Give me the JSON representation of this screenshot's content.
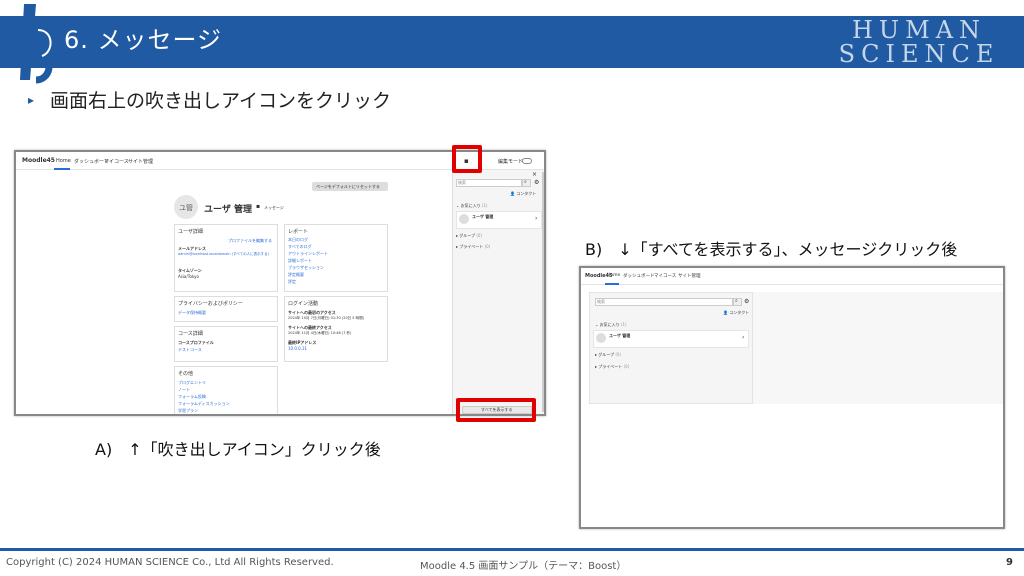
{
  "slide": {
    "title": "6. メッセージ",
    "brand_line1": "HUMAN",
    "brand_line2": "SCIENCE",
    "bullet": "画面右上の吹き出しアイコンをクリック",
    "caption_a": "A)　↑「吹き出しアイコン」クリック後",
    "caption_b": "B)　↓「すべてを表示する」、メッセージクリック後",
    "copyright": "Copyright (C) 2024 HUMAN SCIENCE Co., Ltd All Rights Reserved.",
    "footer_center": "Moodle 4.5 画面サンプル（テーマ：Boost）",
    "page_number": "9"
  },
  "shot_a": {
    "site": "Moodle45",
    "nav": [
      "Home",
      "ダッシュボード",
      "マイコース",
      "サイト管理"
    ],
    "edit_mode": "編集モード",
    "reset_button": "ページをデフォルトにリセットする",
    "avatar_initials": "ユ管",
    "user_name": "ユーザ 管理",
    "message_label": "メッセージ",
    "user_details": {
      "heading": "ユーザ詳細",
      "edit_profile": "プロファイルを編集する",
      "email_label": "メールアドレス",
      "email_value": "admin@localhost.localdomain (すべての人に表示する)",
      "timezone_label": "タイムゾーン",
      "timezone_value": "Asia/Tokyo"
    },
    "privacy": {
      "heading": "プライバシーおよびポリシー",
      "link": "データ保持概要"
    },
    "course": {
      "heading": "コース詳細",
      "label": "コースプロファイル",
      "link": "テストコース"
    },
    "misc": {
      "heading": "その他",
      "links": [
        "ブログエントリ",
        "ノート",
        "フォーラム投稿",
        "フォーラムディスカッション",
        "学習プラン"
      ]
    },
    "reports": {
      "heading": "レポート",
      "links": [
        "本日のログ",
        "すべてのログ",
        "アウトラインレポート",
        "詳細レポート",
        "ブラウザセッション",
        "評定概要",
        "評定"
      ]
    },
    "login": {
      "heading": "ログイン活動",
      "first_label": "サイトへの最初のアクセス",
      "first_value": "2024年 10月 7日(月曜日) 01:30 (20日 5 時間)",
      "last_label": "サイトへの最終アクセス",
      "last_value": "2024年 11月 4日(木曜日) 10:46 (7 秒)",
      "ip_label": "最終IPアドレス",
      "ip_value": "10.0.0.31"
    },
    "drawer": {
      "search_placeholder": "検索",
      "contacts": "コンタクト",
      "starred": "お気に入り",
      "starred_count": "(1)",
      "contact_name": "ユーザ 管理",
      "group": "グループ",
      "group_count": "(0)",
      "private": "プライベート",
      "private_count": "(0)",
      "show_all": "すべてを表示する"
    }
  },
  "shot_b": {
    "site": "Moodle45",
    "nav": [
      "Home",
      "ダッシュボード",
      "マイコース",
      "サイト管理"
    ],
    "search_placeholder": "検索",
    "contacts": "コンタクト",
    "starred": "お気に入り",
    "starred_count": "(1)",
    "contact_name": "ユーザ 管理",
    "group": "グループ",
    "group_count": "(0)",
    "private": "プライベート",
    "private_count": "(0)"
  },
  "colors": {
    "header_blue": "#1f5aa3",
    "highlight_red": "#e00000",
    "link_blue": "#2a6dd6"
  }
}
